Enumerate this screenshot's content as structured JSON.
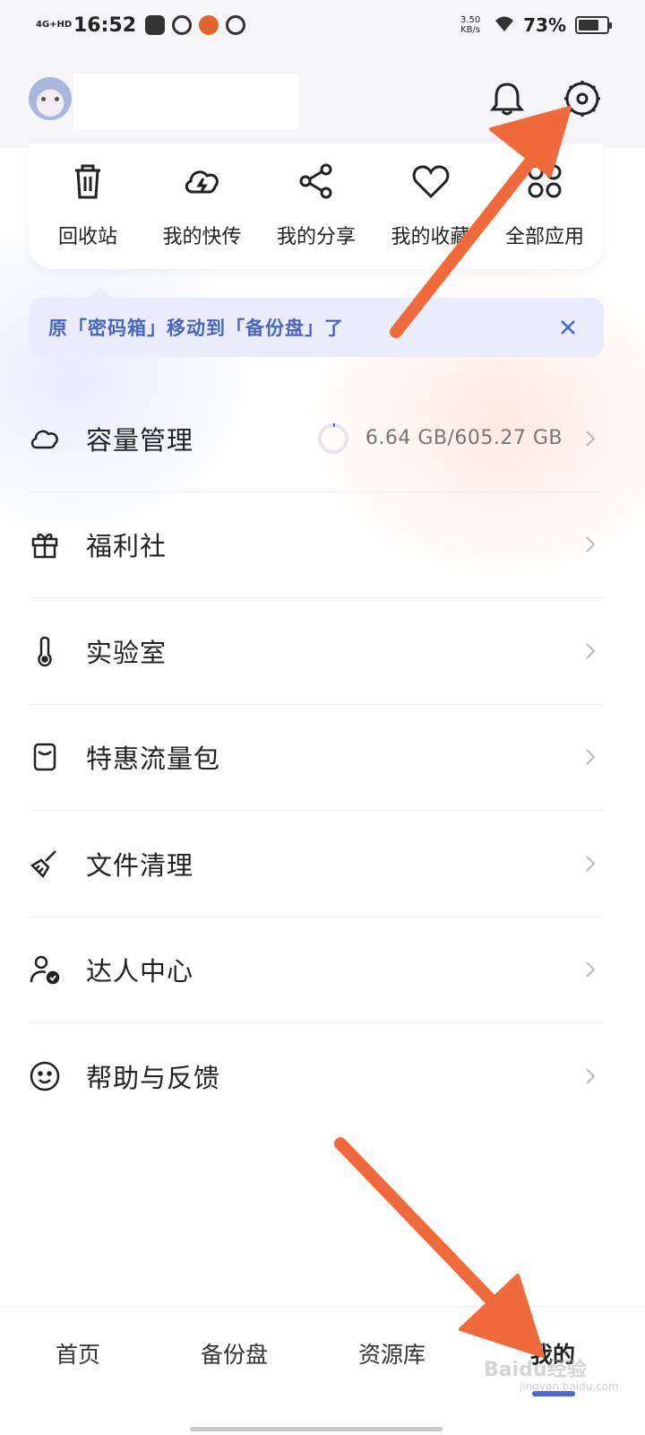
{
  "status_bar": {
    "network": "4G+HD",
    "time": "16:52",
    "speed": "3.50 KB/s",
    "battery": "73%",
    "battery_fraction": 0.73
  },
  "header": {
    "avatar": "avatar",
    "bell_icon": "bell-icon",
    "settings_icon": "gear-icon"
  },
  "quick_actions": [
    {
      "label": "回收站",
      "icon": "trash-icon"
    },
    {
      "label": "我的快传",
      "icon": "cloud-bolt-icon"
    },
    {
      "label": "我的分享",
      "icon": "share-icon"
    },
    {
      "label": "我的收藏",
      "icon": "heart-icon"
    },
    {
      "label": "全部应用",
      "icon": "apps-grid-icon"
    }
  ],
  "notice": {
    "text": "原「密码箱」移动到「备份盘」了"
  },
  "menu": [
    {
      "label": "容量管理",
      "icon": "cloud-icon",
      "value": "6.64 GB/605.27 GB",
      "usage_fraction": 0.011
    },
    {
      "label": "福利社",
      "icon": "gift-icon"
    },
    {
      "label": "实验室",
      "icon": "thermometer-icon"
    },
    {
      "label": "特惠流量包",
      "icon": "data-pack-icon"
    },
    {
      "label": "文件清理",
      "icon": "broom-icon"
    },
    {
      "label": "达人中心",
      "icon": "user-check-icon"
    },
    {
      "label": "帮助与反馈",
      "icon": "smile-icon"
    }
  ],
  "bottom_nav": {
    "tabs": [
      "首页",
      "备份盘",
      "资源库",
      "我的"
    ],
    "active": "我的"
  },
  "watermark": "Baidu经验",
  "watermark_sub": "jingyan.baidu.com",
  "colors": {
    "accent": "#4d65d6",
    "notice_bg": "#e9ecfb",
    "notice_text": "#4a64c4",
    "annotation_arrow": "#f06a3c"
  }
}
